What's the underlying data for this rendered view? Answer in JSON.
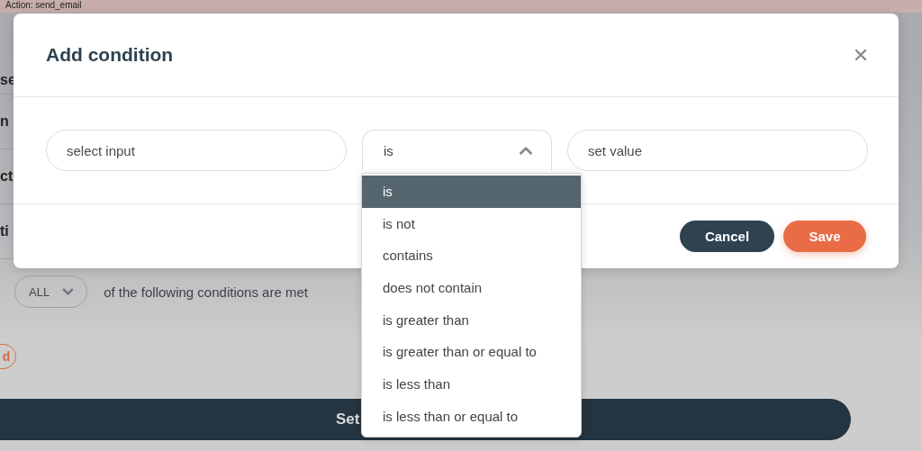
{
  "page": {
    "action_label": "Action: send_email",
    "section_labels": [
      "se",
      "n",
      "ct",
      "ti"
    ],
    "match_select": {
      "value": "ALL"
    },
    "match_text": "of the following conditions are met",
    "add_button": {
      "label": "d"
    },
    "submit_bar": {
      "label": "Set"
    }
  },
  "modal": {
    "title": "Add condition",
    "fields": [
      {
        "kind": "input",
        "placeholder": "select input"
      },
      {
        "kind": "select",
        "value": "is",
        "expanded": true
      },
      {
        "kind": "input",
        "placeholder": "set value"
      }
    ],
    "dropdown": [
      {
        "label": "is",
        "selected": true
      },
      {
        "label": "is not",
        "selected": false
      },
      {
        "label": "contains",
        "selected": false
      },
      {
        "label": "does not contain",
        "selected": false
      },
      {
        "label": "is greater than",
        "selected": false
      },
      {
        "label": "is greater than or equal to",
        "selected": false
      },
      {
        "label": "is less than",
        "selected": false
      },
      {
        "label": "is less than or equal to",
        "selected": false
      }
    ],
    "buttons": [
      {
        "kind": "secondary",
        "label": "Cancel"
      },
      {
        "kind": "primary",
        "label": "Save"
      }
    ]
  }
}
